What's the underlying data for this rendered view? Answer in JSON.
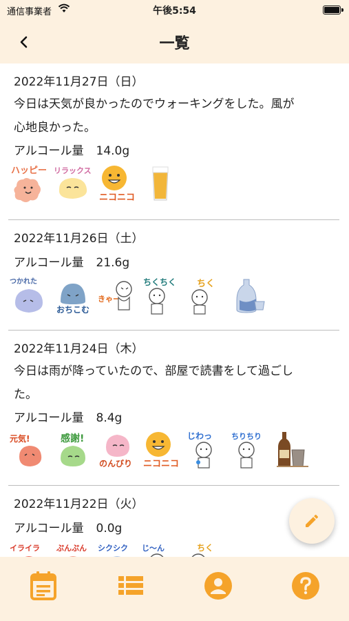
{
  "status": {
    "carrier": "通信事業者",
    "time": "午後5:54"
  },
  "header": {
    "title": "一覧"
  },
  "entries": [
    {
      "date": "2022年11月27日（日）",
      "text_line1": "今日は天気が良かったのでウォーキングをした。風が",
      "text_line2": "心地良かった。",
      "alcohol_label": "アルコール量",
      "alcohol_value": "14.0g",
      "stamps": [
        "ハッピー",
        "リラックス",
        "ニコニコ",
        "beer"
      ]
    },
    {
      "date": "2022年11月26日（土）",
      "alcohol_label": "アルコール量",
      "alcohol_value": "21.6g",
      "stamps": [
        "つかれた",
        "おちこむ",
        "きゃー",
        "ちくちく",
        "ちく",
        "sake"
      ]
    },
    {
      "date": "2022年11月24日（木）",
      "text_line1": "今日は雨が降っていたので、部屋で読書をして過ごし",
      "text_line2": "た。",
      "alcohol_label": "アルコール量",
      "alcohol_value": "8.4g",
      "stamps": [
        "元気!",
        "感謝!",
        "のんびり",
        "ニコニコ",
        "じわっ",
        "ちりちり",
        "shochu"
      ]
    },
    {
      "date": "2022年11月22日（火）",
      "alcohol_label": "アルコール量",
      "alcohol_value": "0.0g",
      "stamps": [
        "イライラ",
        "ぷんぷん",
        "シクシク",
        "じ〜ん",
        "ちく"
      ]
    }
  ],
  "tabs": [
    {
      "icon": "calendar-icon"
    },
    {
      "icon": "list-icon"
    },
    {
      "icon": "profile-icon"
    },
    {
      "icon": "help-icon"
    }
  ],
  "colors": {
    "accent": "#f5a32a",
    "header_bg": "#fdf1e0"
  }
}
